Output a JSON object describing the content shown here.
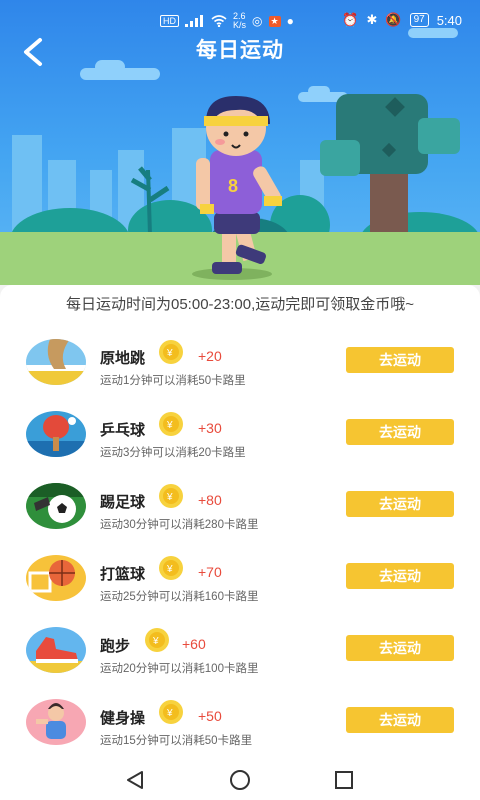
{
  "status_bar": {
    "network": "HD",
    "speed": "2.6\nK/s",
    "battery": "97",
    "time": "5:40"
  },
  "header": {
    "title": "每日运动",
    "back_icon": "back-arrow-icon"
  },
  "notice": "每日运动时间为05:00-23:00,运动完即可领取金币哦~",
  "activities": [
    {
      "name": "原地跳",
      "reward": "+20",
      "desc": "运动1分钟可以消耗50卡路里",
      "button": "去运动",
      "icon": "jump-rope-icon"
    },
    {
      "name": "乒乓球",
      "reward": "+30",
      "desc": "运动3分钟可以消耗20卡路里",
      "button": "去运动",
      "icon": "ping-pong-icon"
    },
    {
      "name": "踢足球",
      "reward": "+80",
      "desc": "运动30分钟可以消耗280卡路里",
      "button": "去运动",
      "icon": "soccer-icon"
    },
    {
      "name": "打篮球",
      "reward": "+70",
      "desc": "运动25分钟可以消耗160卡路里",
      "button": "去运动",
      "icon": "basketball-icon"
    },
    {
      "name": "跑步",
      "reward": "+60",
      "desc": "运动20分钟可以消耗100卡路里",
      "button": "去运动",
      "icon": "running-shoe-icon"
    },
    {
      "name": "健身操",
      "reward": "+50",
      "desc": "运动15分钟可以消耗50卡路里",
      "button": "去运动",
      "icon": "aerobics-icon"
    }
  ],
  "colors": {
    "accent": "#f6c531",
    "reward": "#e84b3c",
    "sky": "#44a5f2",
    "grass": "#9ed27b"
  },
  "navbar": {
    "back": "nav-back-icon",
    "home": "nav-home-icon",
    "recents": "nav-recents-icon"
  }
}
